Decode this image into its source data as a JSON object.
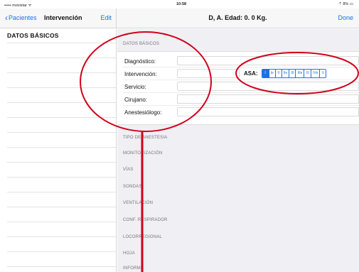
{
  "status_bar": {
    "carrier": "••••• movistar ᯤ",
    "time": "10:58",
    "battery": "⇡ 8% ▭"
  },
  "nav": {
    "back_label": "Pacientes",
    "left_title": "Intervención",
    "edit_label": "Edit",
    "right_title": "D, A. Edad: 0. 0 Kg.",
    "done_label": "Done"
  },
  "sidebar": {
    "section_title": "DATOS BÁSICOS"
  },
  "main": {
    "datos_basicos_header": "DATOS BÁSICOS",
    "fields": [
      "Diagnóstico:",
      "Intervención:",
      "Servicio:",
      "Cirujano:",
      "Anestesiólogo:"
    ],
    "asa": {
      "label": "ASA:",
      "options": [
        "I",
        "Ie",
        "II",
        "IIe",
        "III",
        "IIIe",
        "IV",
        "IVe",
        "V"
      ],
      "selected_index": 0
    },
    "sections": [
      "TIPO DE ANESTESIA",
      "MONITORIZACIÓN",
      "VÍAS",
      "SONDAS",
      "VENTILACIÓN",
      "CONF. RESPIRADOR",
      "LOCORREGIONAL",
      "HOJA",
      "INFORME"
    ]
  },
  "colors": {
    "accent": "#1b72e8",
    "annotation": "#d0021b",
    "background_grouped": "#efeff4"
  }
}
